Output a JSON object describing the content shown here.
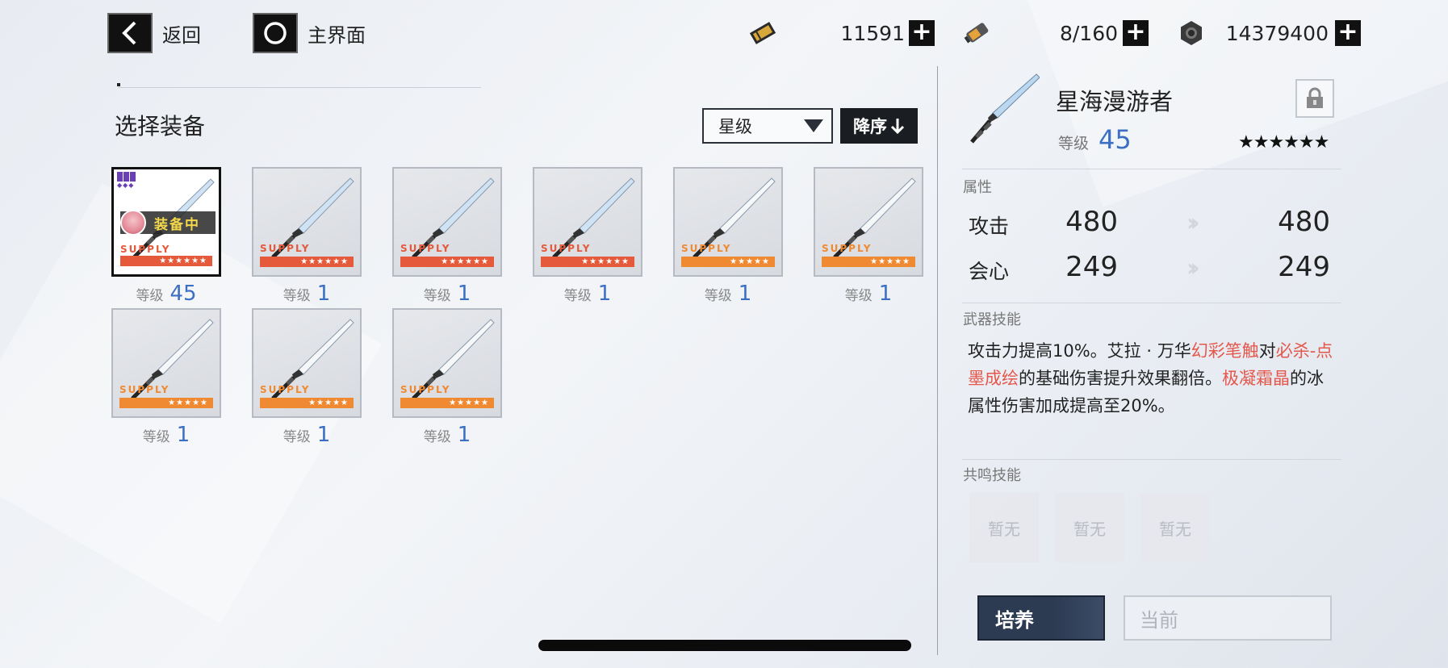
{
  "nav": {
    "back_label": "返回",
    "home_label": "主界面"
  },
  "resources": [
    {
      "icon": "gold-ticket-icon",
      "value": "11591"
    },
    {
      "icon": "energy-cell-icon",
      "value": "8/160"
    },
    {
      "icon": "coin-nut-icon",
      "value": "14379400"
    }
  ],
  "equipment_list": {
    "title": "选择装备",
    "sort_field": "星级",
    "sort_order": "降序",
    "level_label": "等级",
    "items": [
      {
        "tier": "red",
        "supply": "SUPPLY",
        "stars": "★★★★★★",
        "level": "45",
        "equipped": true,
        "equipped_label": "装备中"
      },
      {
        "tier": "red",
        "supply": "SUPPLY",
        "stars": "★★★★★★",
        "level": "1",
        "equipped": false
      },
      {
        "tier": "red",
        "supply": "SUPPLY",
        "stars": "★★★★★★",
        "level": "1",
        "equipped": false
      },
      {
        "tier": "red",
        "supply": "SUPPLY",
        "stars": "★★★★★★",
        "level": "1",
        "equipped": false
      },
      {
        "tier": "orange",
        "supply": "SUPPLY",
        "stars": "★★★★★",
        "level": "1",
        "equipped": false
      },
      {
        "tier": "orange",
        "supply": "SUPPLY",
        "stars": "★★★★★",
        "level": "1",
        "equipped": false
      },
      {
        "tier": "orange",
        "supply": "SUPPLY",
        "stars": "★★★★★",
        "level": "1",
        "equipped": false
      },
      {
        "tier": "orange",
        "supply": "SUPPLY",
        "stars": "★★★★★",
        "level": "1",
        "equipped": false
      },
      {
        "tier": "orange",
        "supply": "SUPPLY",
        "stars": "★★★★★",
        "level": "1",
        "equipped": false
      }
    ]
  },
  "detail": {
    "name": "星海漫游者",
    "level_label": "等级",
    "level": "45",
    "stars": "★★★★★★",
    "attributes_label": "属性",
    "stats": [
      {
        "name": "攻击",
        "current": "480",
        "next": "480"
      },
      {
        "name": "会心",
        "current": "249",
        "next": "249"
      }
    ],
    "weapon_skill_label": "武器技能",
    "weapon_skill_parts": [
      {
        "text": "攻击力提高10%。艾拉 · 万华",
        "hl": false
      },
      {
        "text": "幻彩笔触",
        "hl": true
      },
      {
        "text": "对",
        "hl": false
      },
      {
        "text": "必杀-点墨成绘",
        "hl": true
      },
      {
        "text": "的基础伤害提升效果翻倍。",
        "hl": false
      },
      {
        "text": "极凝霜晶",
        "hl": true
      },
      {
        "text": "的冰属性伤害加成提高至20%。",
        "hl": false
      }
    ],
    "resonance_label": "共鸣技能",
    "resonance_slots": [
      "暂无",
      "暂无",
      "暂无"
    ],
    "train_label": "培养",
    "current_label": "当前"
  },
  "colors": {
    "level_blue": "#3b6fc4",
    "highlight_red": "#e4574a",
    "tier_red": "#e45a3a",
    "tier_orange": "#f08a32"
  }
}
